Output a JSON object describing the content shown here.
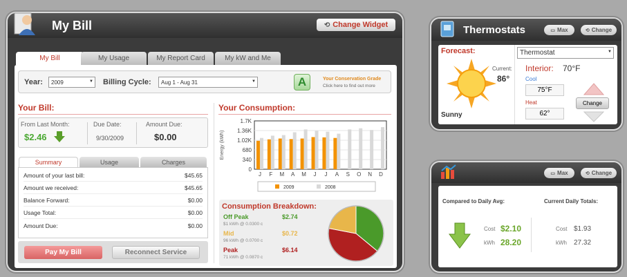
{
  "mybill": {
    "title": "My Bill",
    "change_widget": "Change Widget",
    "tabs": [
      "My Bill",
      "My Usage",
      "My Report Card",
      "My kW and Me"
    ],
    "year_label": "Year:",
    "year_value": "2009",
    "cycle_label": "Billing Cycle:",
    "cycle_value": "Aug 1 - Aug 31",
    "grade_letter": "A",
    "grade_title": "Your Conservation Grade",
    "grade_sub": "Click here to find out more",
    "your_bill": "Your Bill:",
    "from_last_label": "From Last Month:",
    "from_last_value": "$2.46",
    "due_date_label": "Due Date:",
    "due_date_value": "9/30/2009",
    "amount_due_label": "Amount Due:",
    "amount_due_value": "$0.00",
    "summary_tabs": [
      "Summary",
      "Usage",
      "Charges"
    ],
    "summary_rows": [
      {
        "label": "Amount of your last bill:",
        "value": "$45.65"
      },
      {
        "label": "Amount we received:",
        "value": "$45.65"
      },
      {
        "label": "Balance Forward:",
        "value": "$0.00"
      },
      {
        "label": "Usage Total:",
        "value": "$0.00"
      },
      {
        "label": "Amount Due:",
        "value": "$0.00"
      }
    ],
    "pay_button": "Pay My Bill",
    "reconnect_button": "Reconnect Service",
    "consumption_title": "Your Consumption:",
    "breakdown_title": "Consumption Breakdown:",
    "breakdown": [
      {
        "name": "Off Peak",
        "value": "$2.74",
        "detail": "$1 kWh @ 0.0300 c",
        "color": "#4a9a2a"
      },
      {
        "name": "Mid",
        "value": "$0.72",
        "detail": "96 kWh @ 0.0700 c",
        "color": "#e8b64a"
      },
      {
        "name": "Peak",
        "value": "$6.14",
        "detail": "71 kWh @ 0.0870 c",
        "color": "#b02020"
      }
    ]
  },
  "chart_data": {
    "type": "bar",
    "ylabel": "Energy (kWh)",
    "y_ticks": [
      "0",
      "340",
      "680",
      "1.02K",
      "1.36K",
      "1.7K"
    ],
    "ylim": [
      0,
      1700
    ],
    "categories": [
      "J",
      "F",
      "M",
      "A",
      "M",
      "J",
      "J",
      "A",
      "S",
      "O",
      "N",
      "D"
    ],
    "series": [
      {
        "name": "2009",
        "color": "#f39200",
        "values": [
          1000,
          1050,
          1080,
          1060,
          1080,
          1130,
          1120,
          1100,
          null,
          null,
          null,
          null
        ]
      },
      {
        "name": "2008",
        "color": "#d9d9d9",
        "values": [
          1100,
          1180,
          1200,
          1300,
          1400,
          1350,
          1320,
          1250,
          1400,
          1440,
          1380,
          1480
        ]
      }
    ],
    "grid": true,
    "legend": "bottom"
  },
  "pie": {
    "values": [
      0.36,
      0.22,
      0.42
    ]
  },
  "thermostats": {
    "title": "Thermostats",
    "max_label": "Max",
    "change_label": "Change",
    "forecast_label": "Forecast:",
    "current_label": "Current:",
    "current_temp": "86°",
    "condition": "Sunny",
    "select_value": "Thermostat",
    "interior_label": "Interior:",
    "interior_value": "70°F",
    "cool_label": "Cool",
    "cool_value": "75°F",
    "heat_label": "Heat",
    "heat_value": "62°",
    "change_button": "Change"
  },
  "daily": {
    "max_label": "Max",
    "change_label": "Change",
    "compared_label": "Compared to Daily Avg:",
    "totals_label": "Current Daily Totals:",
    "cost_label": "Cost",
    "kwh_label": "kWh",
    "cmp_cost": "$2.10",
    "cmp_kwh": "28.20",
    "cur_cost": "$1.93",
    "cur_kwh": "27.32"
  }
}
